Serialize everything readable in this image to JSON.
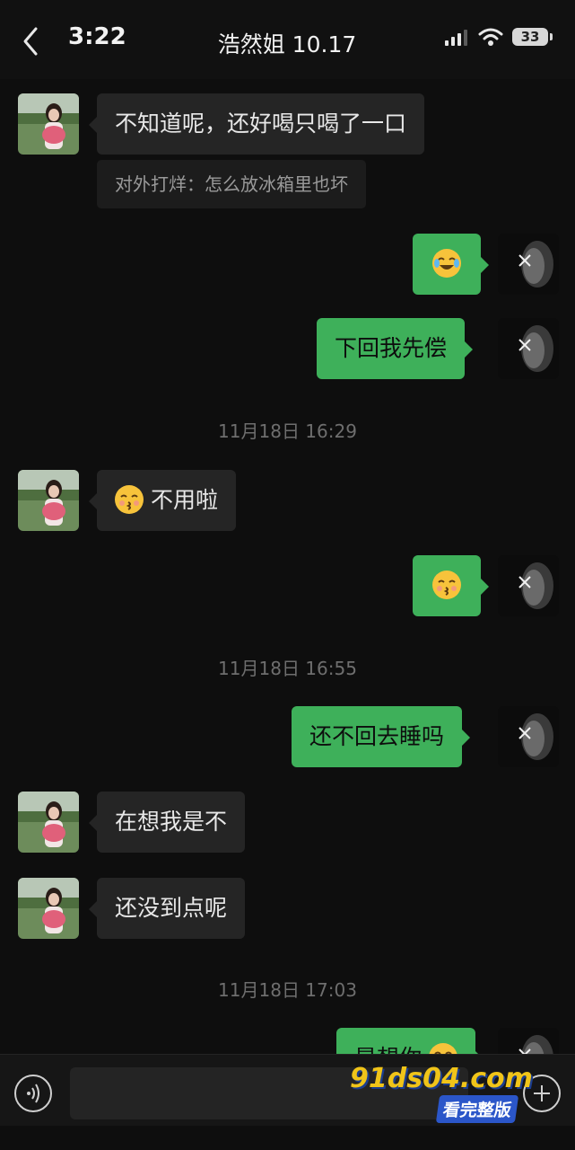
{
  "status_bar": {
    "time": "3:22",
    "battery": "33"
  },
  "header": {
    "title": "浩然姐 10.17"
  },
  "messages": {
    "m1": {
      "text": "不知道呢，还好喝只喝了一口"
    },
    "m1_quote": {
      "text": "对外打烊：怎么放冰箱里也坏"
    },
    "m2": {
      "emoji": "face-with-tears-of-joy"
    },
    "m3": {
      "text": "下回我先偿"
    },
    "ts1": "11月18日 16:29",
    "m4": {
      "emoji": "kissing-face-smiling-eyes",
      "text": "不用啦"
    },
    "m5": {
      "emoji": "kissing-face-smiling-eyes"
    },
    "ts2": "11月18日 16:55",
    "m6": {
      "text": "还不回去睡吗"
    },
    "m7": {
      "text": "在想我是不"
    },
    "m8": {
      "text": "还没到点呢"
    },
    "ts3": "11月18日 17:03",
    "m9": {
      "text": "是想你"
    }
  },
  "watermark": {
    "url": "91ds04.com",
    "tag": "看完整版"
  },
  "colors": {
    "background": "#0e0e0e",
    "bubble_left": "#252525",
    "bubble_right": "#3eb05a",
    "timestamp": "#6e6e6e"
  }
}
